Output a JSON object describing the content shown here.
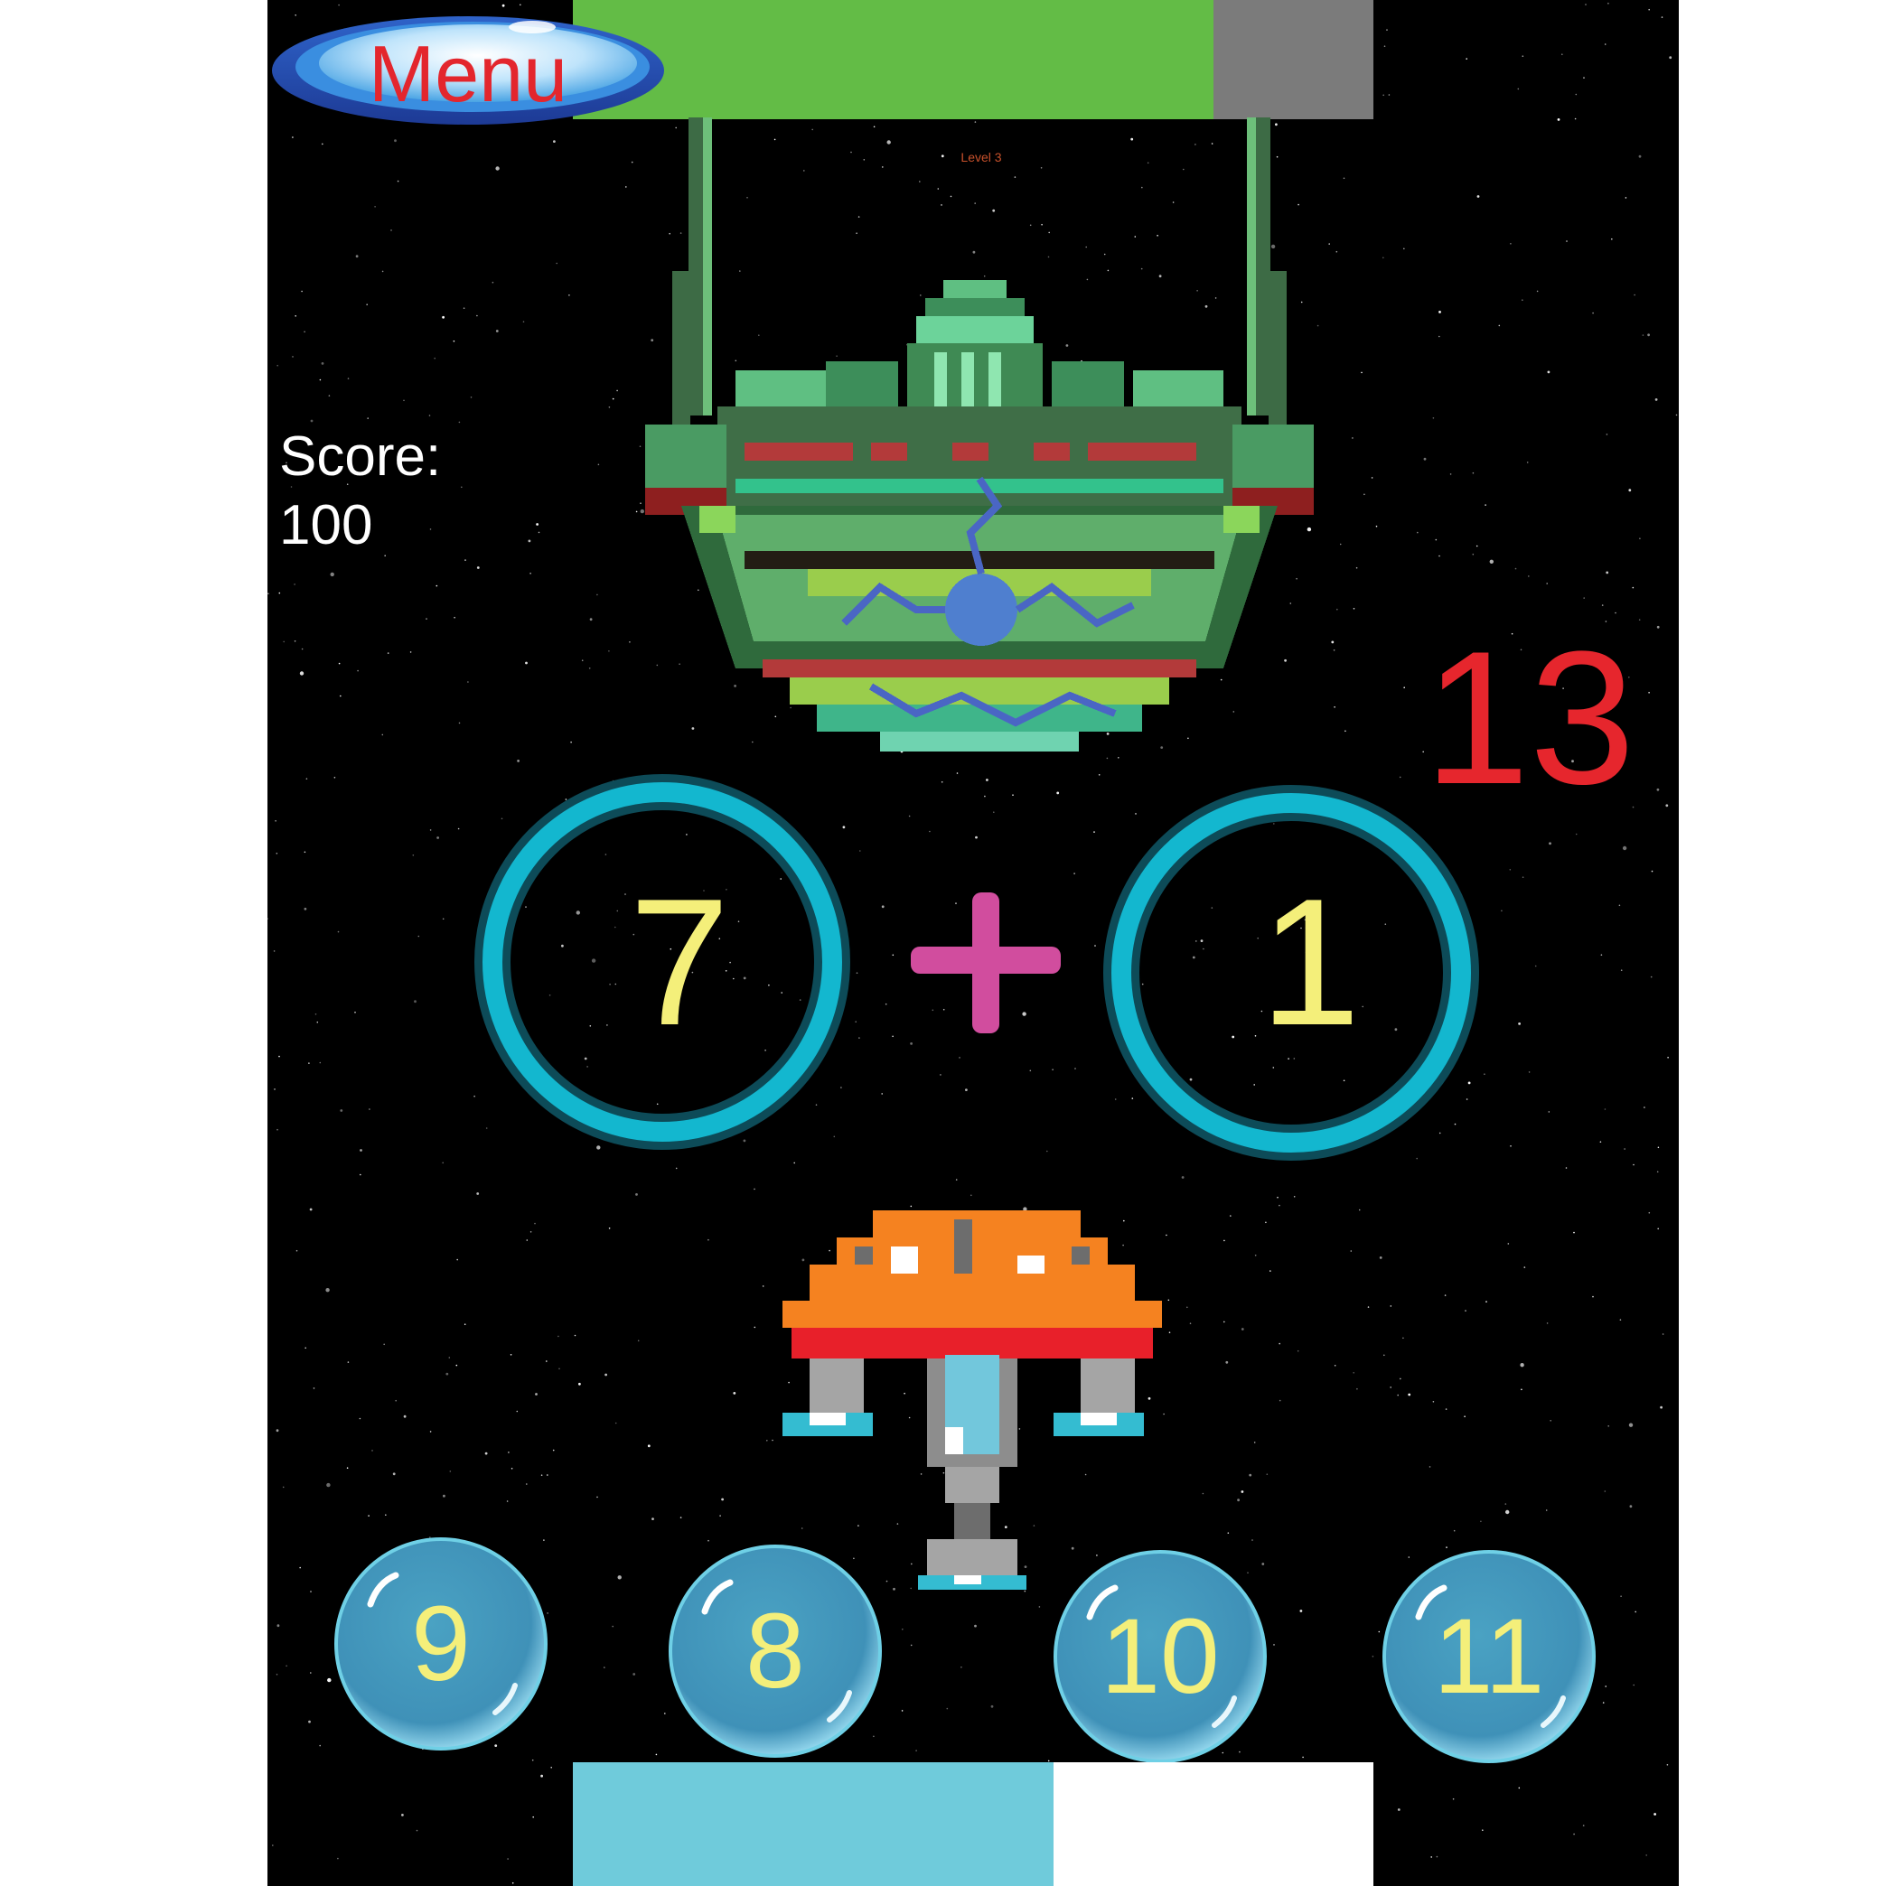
{
  "menu": {
    "label": "Menu"
  },
  "level": {
    "label": "Level 3"
  },
  "score": {
    "label": "Score:",
    "value": "100"
  },
  "target": {
    "value": "13"
  },
  "equation": {
    "left": "7",
    "operator": "+",
    "right": "1"
  },
  "answers": [
    "9",
    "8",
    "10",
    "11"
  ],
  "health_bar": {
    "fill_fraction": 0.8
  },
  "progress_bar": {
    "fill_fraction": 0.6
  },
  "colors": {
    "health_fill": "#63bc46",
    "health_empty": "#7b7b7b",
    "progress_fill": "#6fcbdb",
    "target_text": "#e6262d",
    "operand_text": "#f4ef7a",
    "ring": "#13b7cf",
    "plus": "#d14d9e"
  },
  "icons": {
    "enemy": "alien-mothership-icon",
    "player": "player-spaceship-icon",
    "plus": "plus-icon"
  }
}
